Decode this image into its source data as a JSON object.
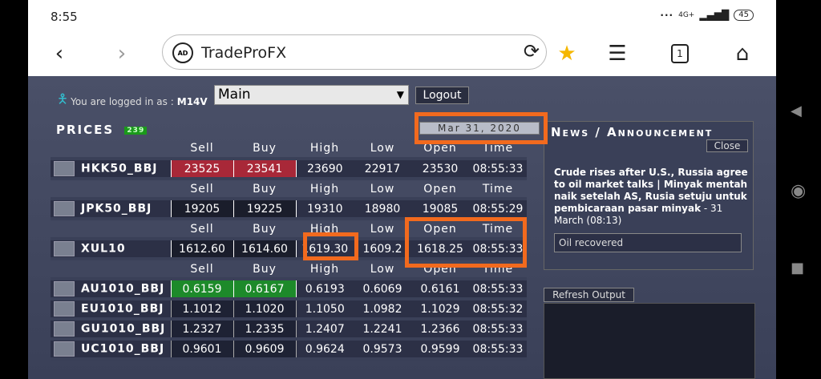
{
  "status": {
    "time": "8:55",
    "signal": "4G+",
    "battery": "45"
  },
  "browser": {
    "url": "TradeProFX",
    "tab_count": "1",
    "ad_label": "AD"
  },
  "account": {
    "logged_text": "You are logged in as :",
    "user": "M14V",
    "selected": "Main",
    "logout": "Logout"
  },
  "prices": {
    "title": "Prices",
    "count": "239",
    "date": "Mar 31, 2020"
  },
  "headers": [
    "Sell",
    "Buy",
    "High",
    "Low",
    "Open",
    "Time"
  ],
  "rows": [
    {
      "sym": "HKK50_BBJ",
      "sell": "23525",
      "buy": "23541",
      "high": "23690",
      "low": "22917",
      "open": "23530",
      "time": "08:55:33",
      "style": "red"
    },
    {
      "sym": "JPK50_BBJ",
      "sell": "19205",
      "buy": "19225",
      "high": "19310",
      "low": "18980",
      "open": "19085",
      "time": "08:55:29",
      "style": "dark"
    },
    {
      "sym": "XUL10",
      "sell": "1612.60",
      "buy": "1614.60",
      "high": "1619.30",
      "low": "1609.2",
      "open": "1618.25",
      "time": "08:55:33",
      "style": "dark"
    },
    {
      "sym": "AU1010_BBJ",
      "sell": "0.6159",
      "buy": "0.6167",
      "high": "0.6193",
      "low": "0.6069",
      "open": "0.6161",
      "time": "08:55:33",
      "style": "green"
    },
    {
      "sym": "EU1010_BBJ",
      "sell": "1.1012",
      "buy": "1.1020",
      "high": "1.1050",
      "low": "1.0982",
      "open": "1.1029",
      "time": "08:55:32",
      "style": "plain"
    },
    {
      "sym": "GU1010_BBJ",
      "sell": "1.2327",
      "buy": "1.2335",
      "high": "1.2407",
      "low": "1.2241",
      "open": "1.2366",
      "time": "08:55:33",
      "style": "plain"
    },
    {
      "sym": "UC1010_BBJ",
      "sell": "0.9601",
      "buy": "0.9609",
      "high": "0.9624",
      "low": "0.9573",
      "open": "0.9599",
      "time": "08:55:33",
      "style": "plain"
    }
  ],
  "news": {
    "title": "News / Announcement",
    "close": "Close",
    "headline": "Crude rises after U.S., Russia agree to oil market talks | Minyak mentah naik setelah AS, Rusia setuju untuk pembicaraan pasar minyak",
    "date": " - 31 March (08:13)",
    "input_value": "Oil recovered"
  },
  "refresh": "Refresh Output",
  "colors": {
    "highlight": "#f26a1e",
    "sell_red": "#a82838",
    "buy_green": "#1d8a2a"
  }
}
